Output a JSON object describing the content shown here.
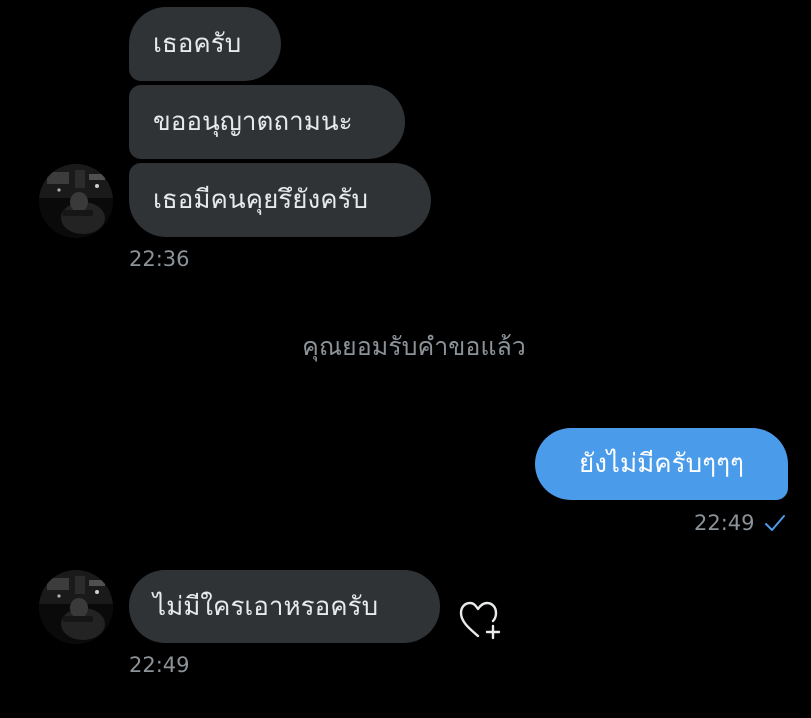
{
  "conversation": {
    "messages": [
      {
        "text": "เธอครับ"
      },
      {
        "text": "ขออนุญาตถามนะ"
      },
      {
        "text": "เธอมีคนคุยรึยังครับ"
      },
      {
        "text": "ยังไม่มีครับๆๆๆ"
      },
      {
        "text": "ไม่มีใครเอาหรอครับ"
      }
    ],
    "timestamps": {
      "first_group": "22:36",
      "sent": "22:49",
      "last": "22:49"
    },
    "system_notice": "คุณยอมรับคำขอแล้ว"
  },
  "icons": {
    "read_receipt": "checkmark-icon",
    "react": "heart-plus-icon",
    "avatar": "profile-avatar"
  },
  "colors": {
    "background": "#000000",
    "incoming_bubble": "#2f3336",
    "outgoing_bubble": "#4a9bea",
    "timestamp": "#8b9298",
    "checkmark": "#4a9bea"
  }
}
